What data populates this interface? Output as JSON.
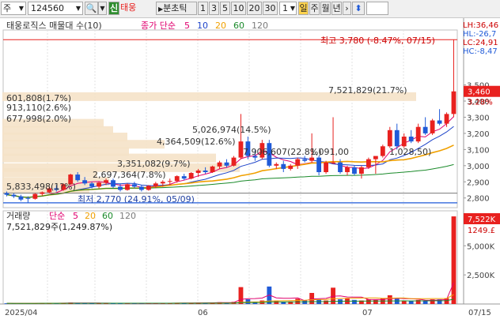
{
  "toolbar": {
    "market": "주",
    "code": "124560",
    "new_btn": "신",
    "stock_name": "태웅",
    "period_label": "분초틱",
    "periods": [
      "1",
      "3",
      "5",
      "10",
      "20",
      "30"
    ],
    "interval_value": "1",
    "units": [
      "일",
      "주",
      "월",
      "년"
    ]
  },
  "price_panel": {
    "title": "태웅로직스 매물대 수(10)",
    "ma_label": "종가 단순",
    "ma_periods": [
      "5",
      "10",
      "20",
      "60",
      "120"
    ],
    "high_note": "최고 3,780 (-8.47%, 07/15)",
    "low_note": "최저 2,770 (24.91%, 05/09)",
    "overlays": {
      "LH": "LH:36,46",
      "HL": "HL:-26,7",
      "LC": "LC:24,91",
      "HC": "HC:-8,47"
    },
    "current_price": "3,460",
    "current_pct": "3.28%",
    "y_ticks": [
      "3,500",
      "3,400",
      "3,300",
      "3,200",
      "3,100",
      "3,000",
      "2,900",
      "2,800"
    ],
    "volume_profile": [
      "7,521,829(21.7%)",
      "601,808(1.7%)",
      "913,110(2.6%)",
      "677,998(2.0%)",
      "5,026,974(14.5%)",
      "4,364,509(12.6%)",
      "7,906,607(22.8%)",
      "1,091,00",
      "1,028,50)",
      "3,351,082(9.7%)",
      "2,697,364(7.8%)",
      "5,833,498(1?%)"
    ]
  },
  "volume_panel": {
    "title": "거래량",
    "ma_label": "단순",
    "ma_periods": [
      "5",
      "20",
      "60",
      "120"
    ],
    "last_volume": "7,521,829주(1,249.87%)",
    "current_tag": "7,522K",
    "current_pct": "1249.£",
    "y_ticks": [
      "5,000K",
      "2,500K"
    ]
  },
  "x_axis": {
    "labels": [
      "2025/04",
      "06",
      "07",
      "07/15"
    ]
  },
  "colors": {
    "up": "#e8211f",
    "down": "#1f5ad8",
    "ma5": "#e0006e",
    "ma10": "#1d43c9",
    "ma20": "#f0a000",
    "ma60": "#1a8a2a",
    "ma120": "#7a7a7a",
    "band": "#f5e2c8"
  },
  "chart_data": {
    "type": "candlestick",
    "y_unit": "KRW",
    "ylim": [
      2740,
      3840
    ],
    "candles": [
      [
        2830,
        2840,
        2810,
        2820
      ],
      [
        2820,
        2830,
        2800,
        2810
      ],
      [
        2810,
        2820,
        2780,
        2790
      ],
      [
        2800,
        2810,
        2770,
        2795
      ],
      [
        2795,
        2830,
        2790,
        2825
      ],
      [
        2825,
        2840,
        2815,
        2835
      ],
      [
        2835,
        2870,
        2830,
        2860
      ],
      [
        2860,
        2880,
        2840,
        2850
      ],
      [
        2850,
        2890,
        2845,
        2885
      ],
      [
        2885,
        2950,
        2880,
        2945
      ],
      [
        2945,
        2960,
        2900,
        2910
      ],
      [
        2910,
        2930,
        2880,
        2890
      ],
      [
        2890,
        2900,
        2860,
        2870
      ],
      [
        2870,
        2900,
        2860,
        2895
      ],
      [
        2895,
        2920,
        2880,
        2910
      ],
      [
        2910,
        2920,
        2860,
        2870
      ],
      [
        2870,
        2890,
        2840,
        2850
      ],
      [
        2850,
        2890,
        2845,
        2885
      ],
      [
        2885,
        2900,
        2860,
        2870
      ],
      [
        2870,
        2880,
        2840,
        2850
      ],
      [
        2850,
        2880,
        2845,
        2875
      ],
      [
        2875,
        2900,
        2860,
        2890
      ],
      [
        2890,
        2910,
        2870,
        2900
      ],
      [
        2900,
        2920,
        2880,
        2905
      ],
      [
        2905,
        2940,
        2895,
        2935
      ],
      [
        2935,
        2950,
        2910,
        2920
      ],
      [
        2920,
        2960,
        2915,
        2955
      ],
      [
        2955,
        2980,
        2930,
        2970
      ],
      [
        2970,
        2990,
        2950,
        2960
      ],
      [
        2960,
        3000,
        2955,
        2995
      ],
      [
        2995,
        3030,
        2980,
        3020
      ],
      [
        3020,
        3040,
        2990,
        3000
      ],
      [
        3000,
        3060,
        2995,
        3050
      ],
      [
        3050,
        3320,
        3040,
        3150
      ],
      [
        3150,
        3180,
        3040,
        3060
      ],
      [
        3060,
        3100,
        3030,
        3050
      ],
      [
        3050,
        3160,
        3040,
        3140
      ],
      [
        3140,
        3160,
        2990,
        3000
      ],
      [
        3000,
        3020,
        2980,
        3010
      ],
      [
        3010,
        3030,
        2960,
        2980
      ],
      [
        2980,
        3010,
        2970,
        3000
      ],
      [
        3000,
        3050,
        2980,
        3040
      ],
      [
        3040,
        3060,
        3020,
        3030
      ],
      [
        3030,
        3200,
        3020,
        3050
      ],
      [
        3050,
        3060,
        2940,
        2960
      ],
      [
        2960,
        3030,
        2950,
        3020
      ],
      [
        3020,
        3300,
        3010,
        3020
      ],
      [
        3020,
        3040,
        2950,
        2960
      ],
      [
        2960,
        3000,
        2940,
        2990
      ],
      [
        2990,
        3000,
        2940,
        2950
      ],
      [
        2950,
        3000,
        2920,
        2990
      ],
      [
        2990,
        3050,
        2980,
        3040
      ],
      [
        3040,
        3050,
        2950,
        3060
      ],
      [
        3060,
        3130,
        3050,
        3120
      ],
      [
        3120,
        3240,
        3110,
        3220
      ],
      [
        3220,
        3260,
        3100,
        3120
      ],
      [
        3120,
        3200,
        3110,
        3180
      ],
      [
        3180,
        3220,
        3140,
        3150
      ],
      [
        3150,
        3260,
        3140,
        3240
      ],
      [
        3240,
        3300,
        3190,
        3200
      ],
      [
        3200,
        3290,
        3190,
        3280
      ],
      [
        3280,
        3350,
        3250,
        3260
      ],
      [
        3260,
        3330,
        3240,
        3320
      ],
      [
        3320,
        3780,
        3300,
        3460
      ]
    ],
    "volume_series": [
      60,
      50,
      50,
      40,
      70,
      80,
      90,
      60,
      70,
      120,
      90,
      70,
      60,
      60,
      80,
      70,
      60,
      50,
      50,
      50,
      60,
      70,
      70,
      80,
      100,
      90,
      80,
      110,
      100,
      120,
      150,
      110,
      180,
      1450,
      400,
      200,
      300,
      1500,
      250,
      200,
      220,
      450,
      300,
      950,
      400,
      300,
      1400,
      400,
      500,
      350,
      300,
      400,
      350,
      500,
      750,
      450,
      300,
      250,
      350,
      300,
      400,
      400,
      500,
      7522
    ]
  }
}
